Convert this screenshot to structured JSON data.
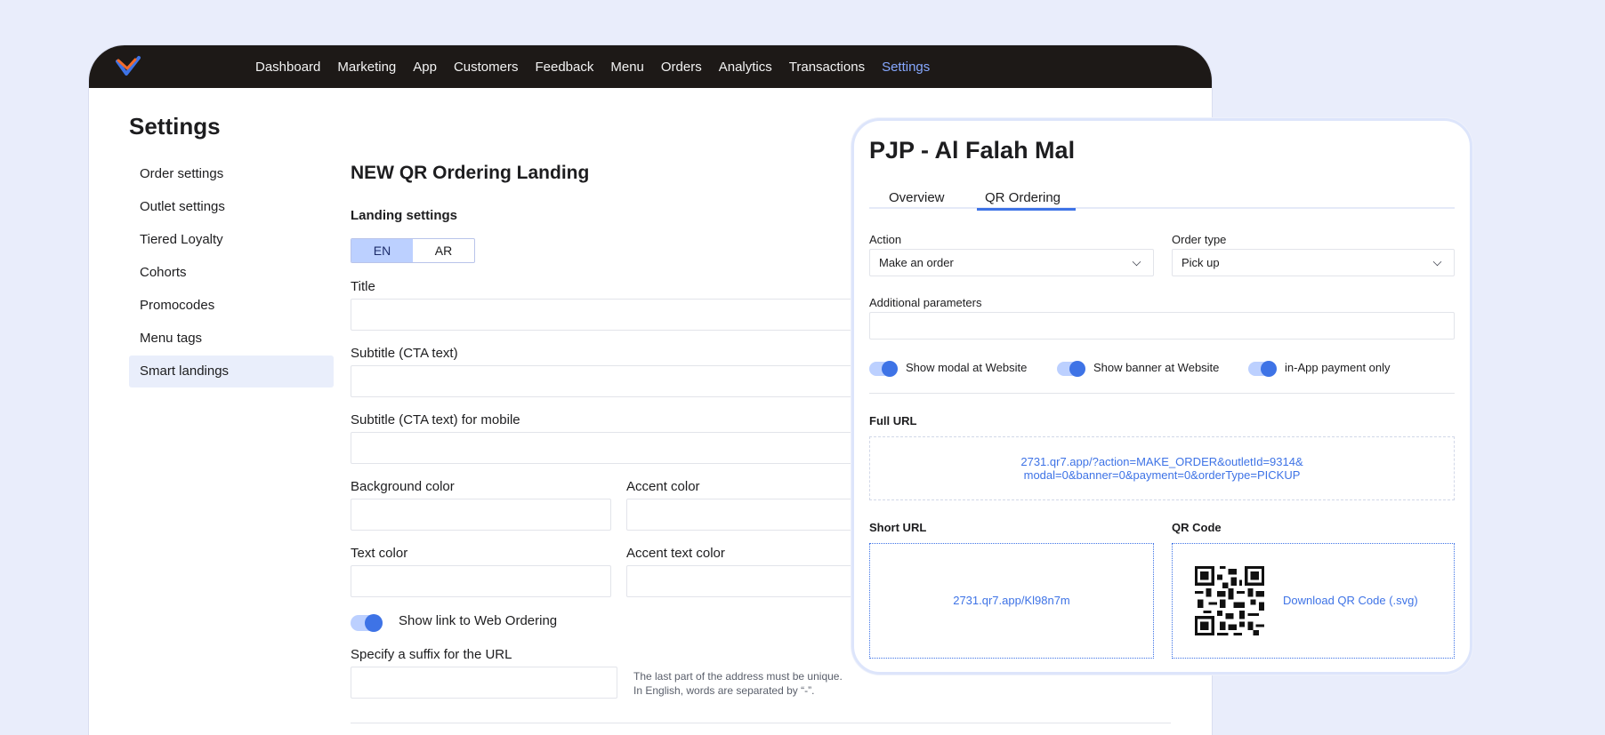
{
  "nav": {
    "items": [
      "Dashboard",
      "Marketing",
      "App",
      "Customers",
      "Feedback",
      "Menu",
      "Orders",
      "Analytics",
      "Transactions",
      "Settings"
    ],
    "active": "Settings"
  },
  "page": {
    "title": "Settings"
  },
  "sidebar": {
    "items": [
      "Order settings",
      "Outlet settings",
      "Tiered Loyalty",
      "Cohorts",
      "Promocodes",
      "Menu tags",
      "Smart landings"
    ],
    "active": "Smart landings"
  },
  "form": {
    "title": "NEW QR Ordering Landing",
    "section": "Landing settings",
    "lang": {
      "en": "EN",
      "ar": "AR",
      "active": "EN"
    },
    "fields": {
      "title": "Title",
      "subtitle": "Subtitle (CTA text)",
      "subtitle_mobile": "Subtitle (CTA text) for mobile",
      "bg_color": "Background color",
      "accent_color": "Accent color",
      "text_color": "Text color",
      "accent_text_color": "Accent text color"
    },
    "web_ordering_toggle": {
      "label": "Show link to Web Ordering",
      "on": true
    },
    "suffix": {
      "label": "Specify a suffix for the URL",
      "hint_line1": "The last part of the address must be unique.",
      "hint_line2": "In English, words are separated by “-”."
    }
  },
  "overlay": {
    "title": "PJP - Al Falah Mal",
    "tabs": [
      "Overview",
      "QR Ordering"
    ],
    "active_tab": "QR Ordering",
    "action": {
      "label": "Action",
      "value": "Make an order"
    },
    "order_type": {
      "label": "Order type",
      "value": "Pick up"
    },
    "additional_params": {
      "label": "Additional parameters",
      "value": ""
    },
    "toggles": [
      {
        "label": "Show modal at Website",
        "on": true
      },
      {
        "label": "Show banner at Website",
        "on": true
      },
      {
        "label": "in-App payment only",
        "on": true
      }
    ],
    "full_url": {
      "label": "Full URL",
      "line1": "2731.qr7.app/?action=MAKE_ORDER&outletId=9314&",
      "line2": "modal=0&banner=0&payment=0&orderType=PICKUP"
    },
    "short_url": {
      "label": "Short URL",
      "value": "2731.qr7.app/Kl98n7m"
    },
    "qr_code": {
      "label": "QR Code",
      "download": "Download QR Code (.svg)"
    }
  },
  "colors": {
    "accent": "#3e73e6",
    "topbar": "#1d1917",
    "nav_active": "#86a8ff",
    "page_bg": "#e9edfb"
  }
}
